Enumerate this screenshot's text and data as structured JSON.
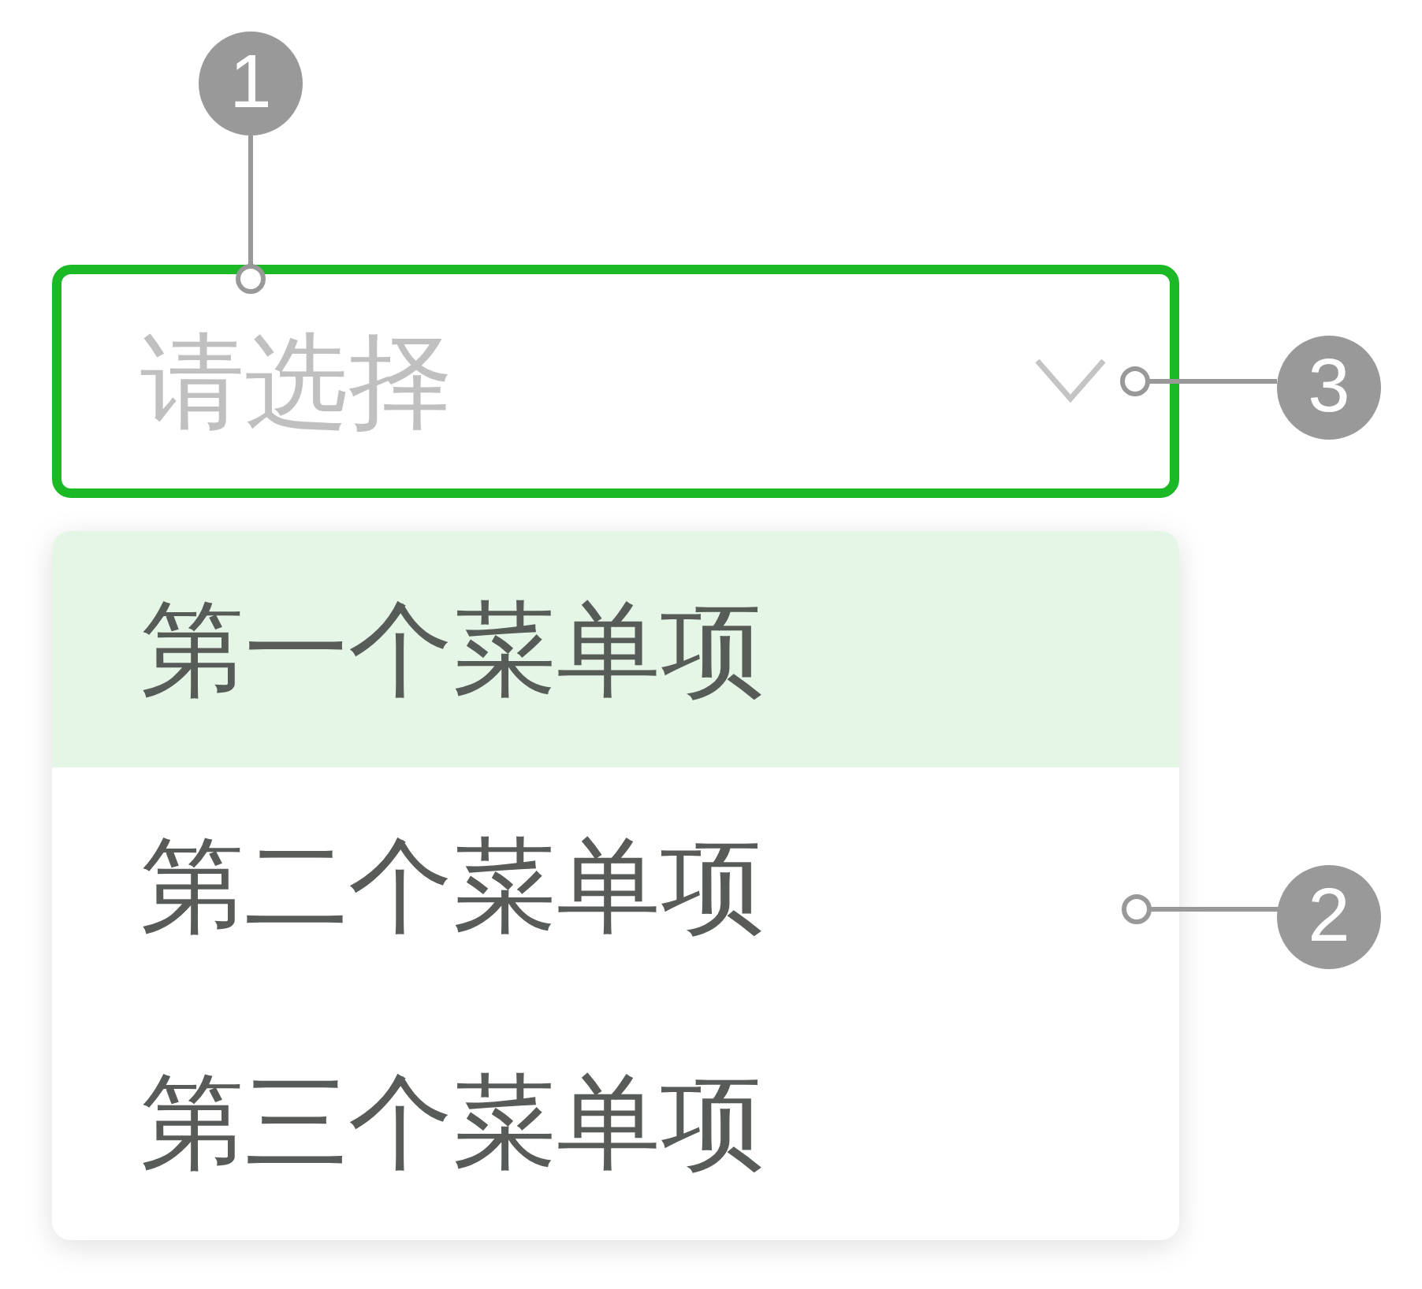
{
  "select": {
    "callout": "1",
    "placeholder": "请选择",
    "focused": true,
    "arrow_callout": "3"
  },
  "menu": {
    "items": [
      {
        "label": "第一个菜单项",
        "selected": true
      },
      {
        "label": "第二个菜单项",
        "selected": false
      },
      {
        "label": "第三个菜单项",
        "selected": false
      }
    ],
    "callout": "2"
  }
}
